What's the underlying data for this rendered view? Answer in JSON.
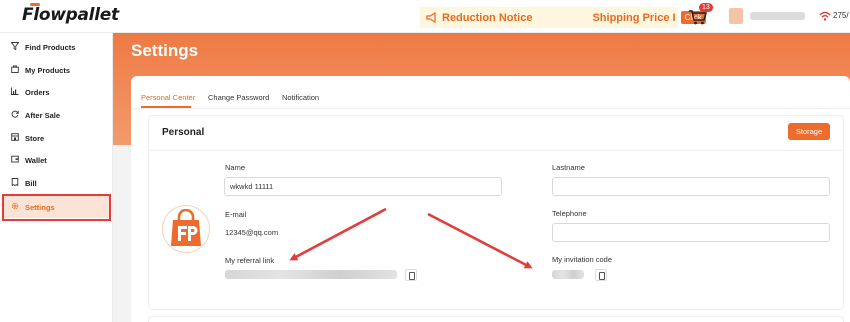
{
  "header": {
    "logo": "Flowpallet",
    "notice_title": "Reduction Notice",
    "notice_scroll": "Shipping Price I",
    "notice_click": "Click",
    "cart_count": "13",
    "signal_text": "275/"
  },
  "sidebar": {
    "items": [
      {
        "label": "Find Products",
        "icon": "filter-icon"
      },
      {
        "label": "My Products",
        "icon": "bag-icon"
      },
      {
        "label": "Orders",
        "icon": "chart-icon"
      },
      {
        "label": "After Sale",
        "icon": "refresh-icon"
      },
      {
        "label": "Store",
        "icon": "store-icon"
      },
      {
        "label": "Wallet",
        "icon": "wallet-icon"
      },
      {
        "label": "Bill",
        "icon": "bill-icon"
      },
      {
        "label": "Settings",
        "icon": "gear-icon"
      }
    ],
    "active": "Settings"
  },
  "page": {
    "title": "Settings",
    "tabs": [
      "Personal Center",
      "Change Password",
      "Notification"
    ],
    "active_tab": "Personal Center"
  },
  "personal": {
    "section_title": "Personal",
    "storage_label": "Storage",
    "name_label": "Name",
    "name_value": "wkwkd 11111",
    "lastname_label": "Lastname",
    "lastname_value": "",
    "email_label": "E-mail",
    "email_value": "12345@qq.com",
    "telephone_label": "Telephone",
    "telephone_value": "",
    "referral_label": "My referral link",
    "invitation_label": "My invitation code"
  },
  "colors": {
    "accent": "#ee6b2e",
    "annotation": "#e23c3c"
  }
}
